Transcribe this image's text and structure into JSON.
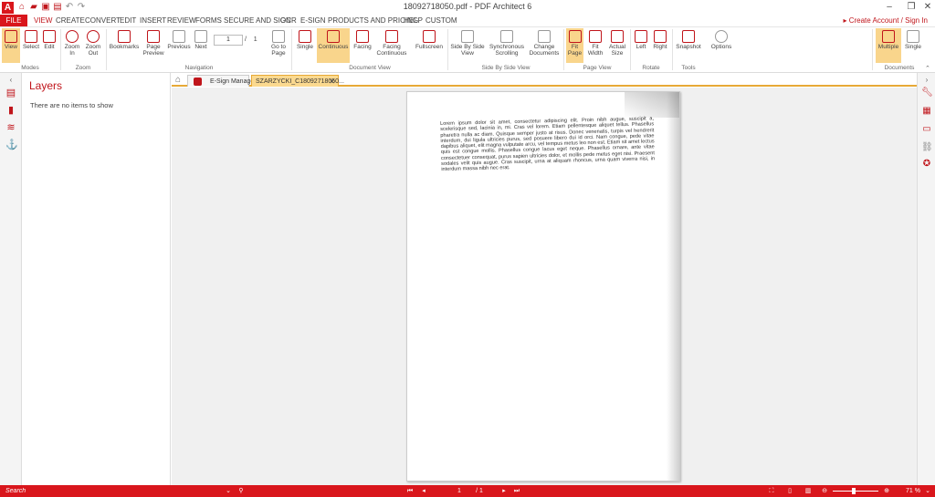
{
  "window": {
    "title": "18092718050.pdf   -   PDF Architect 6",
    "app_logo": "A"
  },
  "menu": {
    "file": "FILE",
    "items": [
      "VIEW",
      "CREATE",
      "CONVERT",
      "EDIT",
      "INSERT",
      "REVIEW",
      "FORMS",
      "SECURE AND SIGN",
      "OCR",
      "E-SIGN",
      "PRODUCTS AND PRICING",
      "HELP",
      "CUSTOM"
    ],
    "active": "VIEW",
    "account_label": "Create Account / Sign In"
  },
  "ribbon": {
    "modes": {
      "view": "View",
      "select": "Select",
      "edit": "Edit",
      "label": "Modes"
    },
    "zoom": {
      "zoom_in_1": "Zoom",
      "zoom_in_2": "In",
      "zoom_out_1": "Zoom",
      "zoom_out_2": "Out",
      "label": "Zoom"
    },
    "navigation": {
      "bookmarks": "Bookmarks",
      "page_preview_1": "Page",
      "page_preview_2": "Preview",
      "previous": "Previous",
      "next": "Next",
      "current_page": "1",
      "separator": "/",
      "total_pages": "1",
      "goto_1": "Go to",
      "goto_2": "Page",
      "label": "Navigation"
    },
    "document_view": {
      "single": "Single",
      "continuous": "Continuous",
      "facing": "Facing",
      "facing_cont_1": "Facing",
      "facing_cont_2": "Continuous",
      "fullscreen": "Fullscreen",
      "label": "Document View"
    },
    "side_by_side": {
      "sbs_1": "Side By Side",
      "sbs_2": "View",
      "sync_1": "Synchronous",
      "sync_2": "Scrolling",
      "change_1": "Change",
      "change_2": "Documents",
      "label": "Side By Side View"
    },
    "page_view": {
      "fit_page_1": "Fit",
      "fit_page_2": "Page",
      "fit_width_1": "Fit",
      "fit_width_2": "Width",
      "actual_1": "Actual",
      "actual_2": "Size",
      "label": "Page View"
    },
    "rotate": {
      "left": "Left",
      "right": "Right",
      "label": "Rotate"
    },
    "tools": {
      "snapshot": "Snapshot",
      "options": "Options",
      "label": "Tools"
    },
    "documents": {
      "multiple": "Multiple",
      "single": "Single",
      "label": "Documents"
    }
  },
  "panel": {
    "title": "Layers",
    "empty_text": "There are no items to show"
  },
  "tabs": [
    {
      "label": "E-Sign Manager",
      "active": false
    },
    {
      "label": "SZARZYCKI_C18092718050...",
      "active": true
    }
  ],
  "document": {
    "text": "Lorem ipsum dolor sit amet, consectetur adipiscing elit. Proin nibh augue, suscipit a, scelerisque sed, lacinia in, mi. Cras vel lorem. Etiam pellentesque aliquet tellus. Phasellus pharetra nulla ac diam. Quisque semper justo at risus. Donec venenatis, turpis vel hendrerit interdum, dui ligula ultricies purus, sed posuere libero dui id orci. Nam congue, pede vitae dapibus aliquet, elit magna vulputate arcu, vel tempus metus leo non est. Etiam sit amet lectus quis est congue mollis. Phasellus congue lacus eget neque. Phasellus ornare, ante vitae consectetuer consequat, purus sapien ultricies dolor, et mollis pede metus eget nisi. Praesent sodales velit quis augue. Cras suscipit, urna at aliquam rhoncus, urna quam viverra nisi, in interdum massa nibh nec erat."
  },
  "status": {
    "search_placeholder": "Search",
    "page_current": "1",
    "page_total": "/ 1",
    "zoom_level": "71 %",
    "zoom_fraction": 0.45
  },
  "colors": {
    "accent": "#d9161c",
    "highlight": "#f9d58c",
    "tab_border": "#e7a936"
  }
}
